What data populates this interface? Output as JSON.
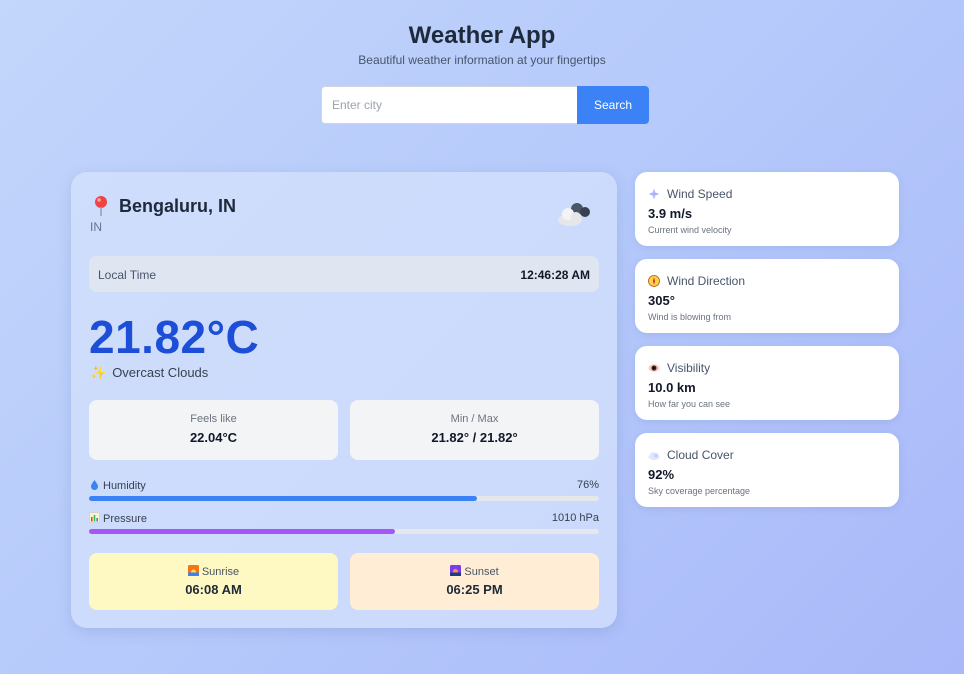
{
  "header": {
    "title": "Weather App",
    "subtitle": "Beautiful weather information at your fingertips"
  },
  "search": {
    "placeholder": "Enter city",
    "value": "",
    "button_label": "Search"
  },
  "main": {
    "city": "Bengaluru, IN",
    "country": "IN",
    "weather_icon": "clouds-icon",
    "local_time_label": "Local Time",
    "local_time": "12:46:28 AM",
    "temperature": "21.82°C",
    "description": "Overcast Clouds",
    "feels_like_label": "Feels like",
    "feels_like": "22.04°C",
    "minmax_label": "Min / Max",
    "minmax": "21.82° / 21.82°",
    "humidity_label": "Humidity",
    "humidity": "76%",
    "humidity_fraction": 0.76,
    "pressure_label": "Pressure",
    "pressure": "1010 hPa",
    "pressure_fraction": 0.6,
    "sunrise_label": "Sunrise",
    "sunrise": "06:08 AM",
    "sunset_label": "Sunset",
    "sunset": "06:25 PM"
  },
  "side": [
    {
      "icon": "wind-icon",
      "label": "Wind Speed",
      "value": "3.9 m/s",
      "note": "Current wind velocity"
    },
    {
      "icon": "compass-icon",
      "label": "Wind Direction",
      "value": "305°",
      "note": "Wind is blowing from"
    },
    {
      "icon": "eye-icon",
      "label": "Visibility",
      "value": "10.0 km",
      "note": "How far you can see"
    },
    {
      "icon": "cloud-icon",
      "label": "Cloud Cover",
      "value": "92%",
      "note": "Sky coverage percentage"
    }
  ],
  "colors": {
    "accent": "#3b82f6",
    "temperature": "#1d4ed8",
    "humidity_bar": "#3b82f6",
    "pressure_bar": "#a855f7",
    "sunrise_bg": "#fef9c3",
    "sunset_bg": "#ffedd5"
  }
}
